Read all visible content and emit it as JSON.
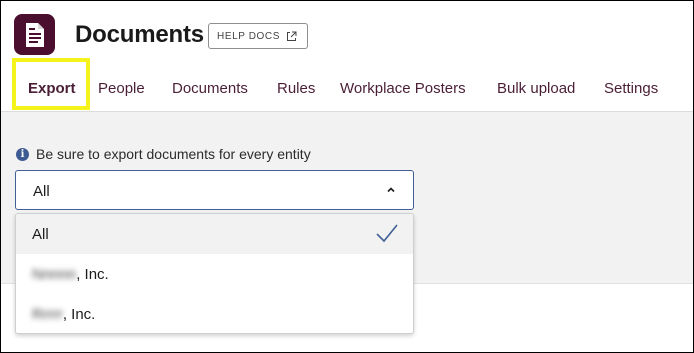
{
  "header": {
    "title": "Documents",
    "help_label": "HELP DOCS",
    "app_icon": "document-icon",
    "help_icon": "external-link-icon"
  },
  "tabs": [
    {
      "label": "Export",
      "active": true
    },
    {
      "label": "People"
    },
    {
      "label": "Documents"
    },
    {
      "label": "Rules"
    },
    {
      "label": "Workplace Posters"
    },
    {
      "label": "Bulk upload"
    },
    {
      "label": "Settings"
    }
  ],
  "export": {
    "info_text": "Be sure to export documents for every entity",
    "info_icon": "info-icon",
    "select_value": "All",
    "options": [
      {
        "label": "All",
        "selected": true
      },
      {
        "label_suffix": ", Inc.",
        "redacted": "Nnnnn"
      },
      {
        "label_suffix": ", Inc.",
        "redacted": "Rrrrr"
      }
    ]
  },
  "colors": {
    "brand": "#4a0f2f",
    "accent": "#3f5f95",
    "highlight": "#f4f41a",
    "tab_text": "#4a1f35"
  }
}
